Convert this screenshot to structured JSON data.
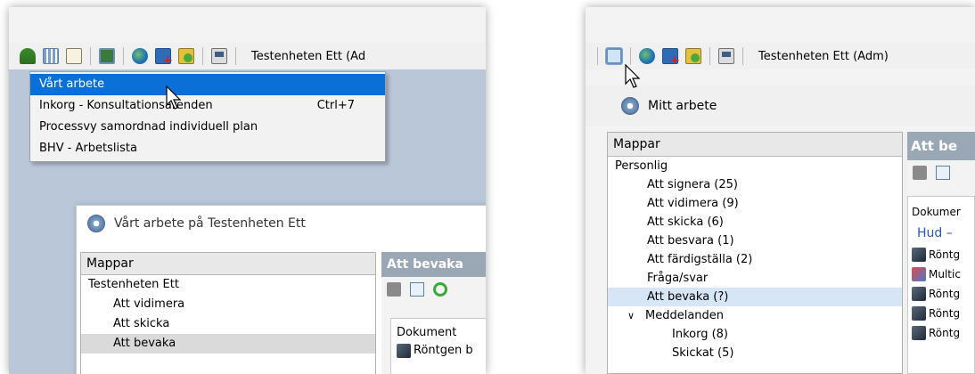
{
  "left": {
    "toolbar_label": "Testenheten Ett (Ad",
    "menu": [
      {
        "label": "Vårt arbete",
        "shortcut": ""
      },
      {
        "label": "Inkorg - Konsultationsärenden",
        "shortcut": "Ctrl+7"
      },
      {
        "label": "Processvy samordnad individuell plan",
        "shortcut": ""
      },
      {
        "label": "BHV - Arbetslista",
        "shortcut": ""
      }
    ],
    "window": {
      "title": "Vårt arbete på Testenheten Ett",
      "folders_header": "Mappar",
      "tree": [
        "Testenheten Ett",
        "Att vidimera",
        "Att skicka",
        "Att bevaka"
      ],
      "right_header": "Att bevaka",
      "doc_header": "Dokument",
      "doc_row": "Röntgen b"
    }
  },
  "right": {
    "toolbar_label": "Testenheten Ett (Adm)",
    "window_title": "Mitt arbete",
    "folders_header": "Mappar",
    "tree": {
      "root": "Personlig",
      "items": [
        "Att signera (25)",
        "Att vidimera (9)",
        "Att skicka (6)",
        "Att besvara (1)",
        "Att färdigställa (2)",
        "Fråga/svar",
        "Att bevaka (?)"
      ],
      "group": "Meddelanden",
      "group_items": [
        "Inkorg (8)",
        "Skickat (5)"
      ]
    },
    "right_header": "Att be",
    "doc_header": "Dokumer",
    "doc_sub": "Hud –",
    "doc_rows": [
      "Röntg",
      "Multic",
      "Röntg",
      "Röntg",
      "Röntg"
    ]
  },
  "colors": {
    "accent": "#0a6fd6",
    "header": "#9aa7b5",
    "selected": "#d6e6f6"
  }
}
